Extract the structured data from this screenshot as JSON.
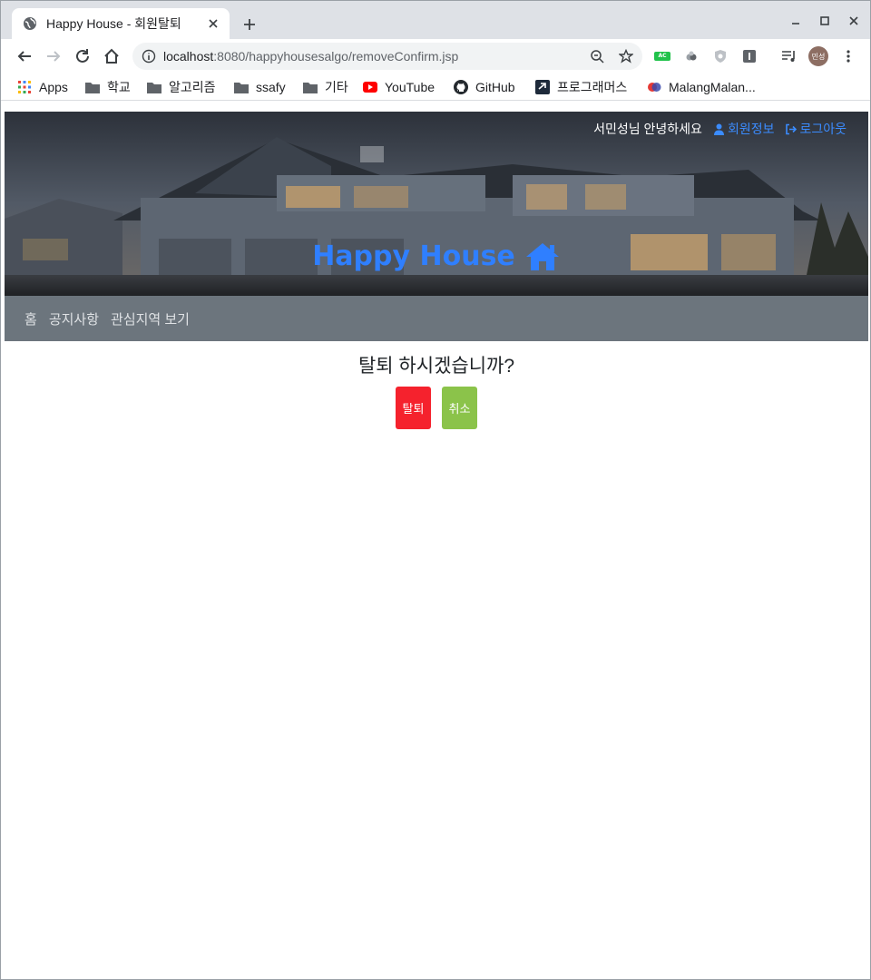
{
  "browser": {
    "tab_title": "Happy House - 회원탈퇴",
    "url_host": "localhost",
    "url_rest": ":8080/happyhousesalgo/removeConfirm.jsp",
    "avatar_text": "민성",
    "extension_badge": "AC"
  },
  "bookmarks": [
    {
      "label": "Apps",
      "icon": "apps-grid-icon"
    },
    {
      "label": "학교",
      "icon": "folder-icon"
    },
    {
      "label": "알고리즘",
      "icon": "folder-icon"
    },
    {
      "label": "ssafy",
      "icon": "folder-icon"
    },
    {
      "label": "기타",
      "icon": "folder-icon"
    },
    {
      "label": "YouTube",
      "icon": "youtube-icon"
    },
    {
      "label": "GitHub",
      "icon": "github-icon"
    },
    {
      "label": "프로그래머스",
      "icon": "programmers-icon"
    },
    {
      "label": "MalangMalan...",
      "icon": "malang-icon"
    }
  ],
  "header": {
    "greeting": "서민성님 안녕하세요",
    "member_info": "회원정보",
    "logout": "로그아웃",
    "brand": "Happy House"
  },
  "nav": {
    "items": [
      "홈",
      "공지사항",
      "관심지역 보기"
    ]
  },
  "main": {
    "question": "탈퇴 하시겠습니까?",
    "withdraw_label": "탈퇴",
    "cancel_label": "취소"
  },
  "colors": {
    "brand": "#2f7fff",
    "link": "#3b8cff",
    "nav_bg": "#6c757d",
    "danger": "#f5222d",
    "cancel": "#8bc34a"
  }
}
